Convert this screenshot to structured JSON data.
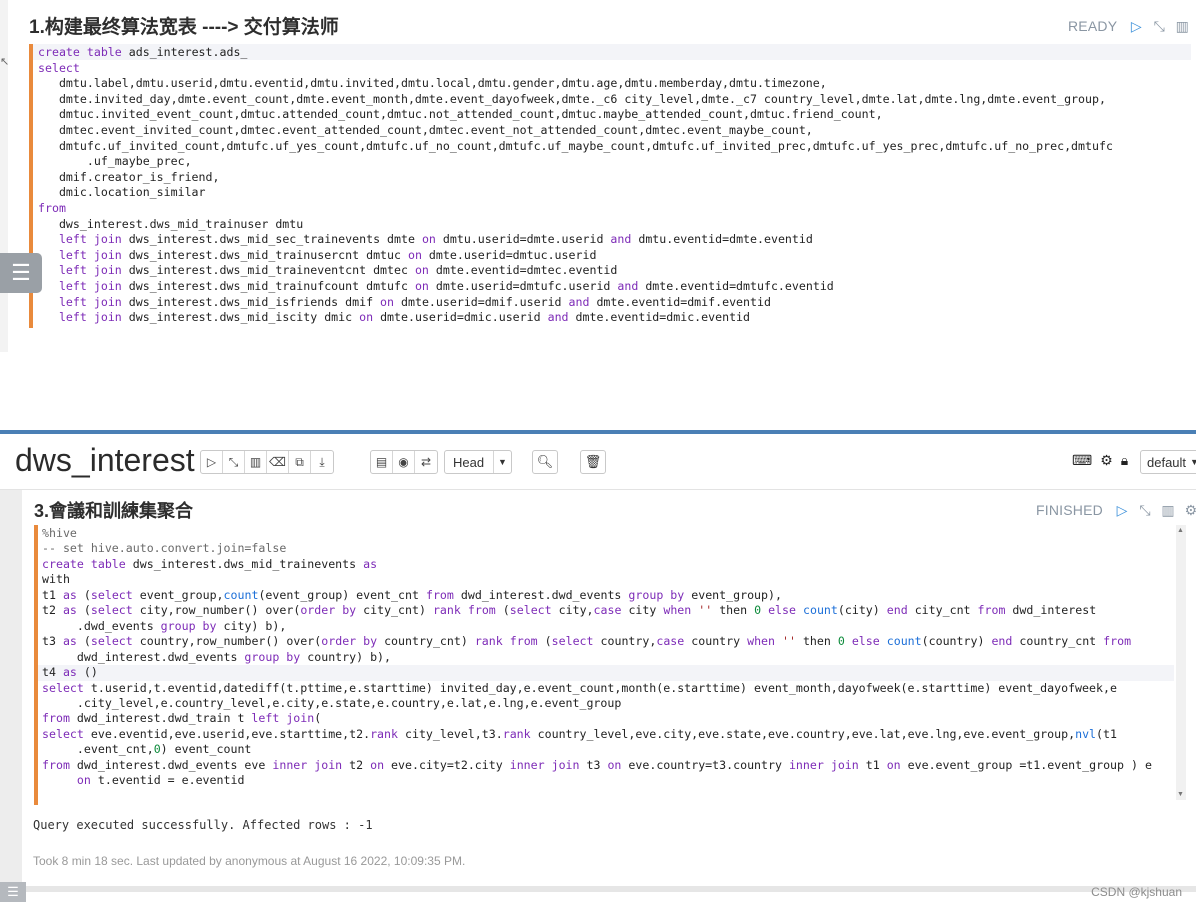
{
  "top_paragraph": {
    "title": "1.构建最终算法宽表 ----> 交付算法师",
    "status": "READY",
    "code_lines": [
      [
        [
          "kw",
          "create table "
        ],
        [
          "",
          "ads_interest.ads_"
        ]
      ],
      [
        [
          "kw",
          "select"
        ]
      ],
      [
        [
          "",
          "   dmtu.label,dmtu.userid,dmtu.eventid,dmtu.invited,dmtu.local,dmtu.gender,dmtu.age,dmtu.memberday,dmtu.timezone,"
        ]
      ],
      [
        [
          "",
          "   dmte.invited_day,dmte.event_count,dmte.event_month,dmte.event_dayofweek,dmte._c6 city_level,dmte._c7 country_level,dmte.lat,dmte.lng,dmte.event_group,"
        ]
      ],
      [
        [
          "",
          "   dmtuc.invited_event_count,dmtuc.attended_count,dmtuc.not_attended_count,dmtuc.maybe_attended_count,dmtuc.friend_count,"
        ]
      ],
      [
        [
          "",
          "   dmtec.event_invited_count,dmtec.event_attended_count,dmtec.event_not_attended_count,dmtec.event_maybe_count,"
        ]
      ],
      [
        [
          "",
          "   dmtufc.uf_invited_count,dmtufc.uf_yes_count,dmtufc.uf_no_count,dmtufc.uf_maybe_count,dmtufc.uf_invited_prec,dmtufc.uf_yes_prec,dmtufc.uf_no_prec,dmtufc"
        ]
      ],
      [
        [
          "",
          "       .uf_maybe_prec,"
        ]
      ],
      [
        [
          "",
          "   dmif.creator_is_friend,"
        ]
      ],
      [
        [
          "",
          "   dmic.location_similar"
        ]
      ],
      [
        [
          "kw",
          "from"
        ]
      ],
      [
        [
          "",
          "   dws_interest.dws_mid_trainuser dmtu"
        ]
      ],
      [
        [
          "",
          "   "
        ],
        [
          "kw",
          "left join "
        ],
        [
          "",
          "dws_interest.dws_mid_sec_trainevents dmte "
        ],
        [
          "kw",
          "on "
        ],
        [
          "",
          "dmtu.userid=dmte.userid "
        ],
        [
          "kw",
          "and "
        ],
        [
          "",
          "dmtu.eventid=dmte.eventid"
        ]
      ],
      [
        [
          "",
          "   "
        ],
        [
          "kw",
          "left join "
        ],
        [
          "",
          "dws_interest.dws_mid_trainusercnt dmtuc "
        ],
        [
          "kw",
          "on "
        ],
        [
          "",
          "dmte.userid=dmtuc.userid"
        ]
      ],
      [
        [
          "",
          "   "
        ],
        [
          "kw",
          "left join "
        ],
        [
          "",
          "dws_interest.dws_mid_traineventcnt dmtec "
        ],
        [
          "kw",
          "on "
        ],
        [
          "",
          "dmte.eventid=dmtec.eventid"
        ]
      ],
      [
        [
          "",
          "   "
        ],
        [
          "kw",
          "left join "
        ],
        [
          "",
          "dws_interest.dws_mid_trainufcount dmtufc "
        ],
        [
          "kw",
          "on "
        ],
        [
          "",
          "dmte.userid=dmtufc.userid "
        ],
        [
          "kw",
          "and "
        ],
        [
          "",
          "dmte.eventid=dmtufc.eventid"
        ]
      ],
      [
        [
          "",
          "   "
        ],
        [
          "kw",
          "left join "
        ],
        [
          "",
          "dws_interest.dws_mid_isfriends dmif "
        ],
        [
          "kw",
          "on "
        ],
        [
          "",
          "dmte.userid=dmif.userid "
        ],
        [
          "kw",
          "and "
        ],
        [
          "",
          "dmte.eventid=dmif.eventid"
        ]
      ],
      [
        [
          "",
          "   "
        ],
        [
          "kw",
          "left join "
        ],
        [
          "",
          "dws_interest.dws_mid_iscity dmic "
        ],
        [
          "kw",
          "on "
        ],
        [
          "",
          "dmte.userid=dmic.userid "
        ],
        [
          "kw",
          "and "
        ],
        [
          "",
          "dmte.eventid=dmic.eventid"
        ]
      ]
    ]
  },
  "notebook": {
    "title": "dws_interest",
    "head_label": "Head",
    "mode_label": "default"
  },
  "bottom_paragraph": {
    "title": "3.會議和訓練集聚合",
    "status": "FINISHED",
    "code_lines": [
      [
        [
          "cm",
          "%hive"
        ]
      ],
      [
        [
          "cm",
          "-- set hive.auto.convert.join=false"
        ]
      ],
      [
        [
          "kw",
          "create table "
        ],
        [
          "",
          "dws_interest.dws_mid_trainevents "
        ],
        [
          "kw",
          "as"
        ]
      ],
      [
        [
          "",
          "with"
        ]
      ],
      [
        [
          "",
          "t1 "
        ],
        [
          "kw",
          "as "
        ],
        [
          "",
          "("
        ],
        [
          "kw",
          "select "
        ],
        [
          "",
          "event_group,"
        ],
        [
          "fn",
          "count"
        ],
        [
          "",
          "(event_group) event_cnt "
        ],
        [
          "kw",
          "from "
        ],
        [
          "",
          "dwd_interest.dwd_events "
        ],
        [
          "kw",
          "group by "
        ],
        [
          "",
          "event_group),"
        ]
      ],
      [
        [
          "",
          "t2 "
        ],
        [
          "kw",
          "as "
        ],
        [
          "",
          "("
        ],
        [
          "kw",
          "select "
        ],
        [
          "",
          "city,row_number() over("
        ],
        [
          "kw",
          "order by "
        ],
        [
          "",
          "city_cnt) "
        ],
        [
          "kw",
          "rank from "
        ],
        [
          "",
          "("
        ],
        [
          "kw",
          "select "
        ],
        [
          "",
          "city,"
        ],
        [
          "kw",
          "case "
        ],
        [
          "",
          "city "
        ],
        [
          "kw",
          "when "
        ],
        [
          "str",
          "'' "
        ],
        [
          "",
          "then "
        ],
        [
          "num",
          "0 "
        ],
        [
          "kw",
          "else "
        ],
        [
          "fn",
          "count"
        ],
        [
          "",
          "(city) "
        ],
        [
          "kw",
          "end "
        ],
        [
          "",
          "city_cnt "
        ],
        [
          "kw",
          "from "
        ],
        [
          "",
          "dwd_interest"
        ]
      ],
      [
        [
          "",
          "     .dwd_events "
        ],
        [
          "kw",
          "group by "
        ],
        [
          "",
          "city) b),"
        ]
      ],
      [
        [
          "",
          "t3 "
        ],
        [
          "kw",
          "as "
        ],
        [
          "",
          "("
        ],
        [
          "kw",
          "select "
        ],
        [
          "",
          "country,row_number() over("
        ],
        [
          "kw",
          "order by "
        ],
        [
          "",
          "country_cnt) "
        ],
        [
          "kw",
          "rank from "
        ],
        [
          "",
          "("
        ],
        [
          "kw",
          "select "
        ],
        [
          "",
          "country,"
        ],
        [
          "kw",
          "case "
        ],
        [
          "",
          "country "
        ],
        [
          "kw",
          "when "
        ],
        [
          "str",
          "'' "
        ],
        [
          "",
          "then "
        ],
        [
          "num",
          "0 "
        ],
        [
          "kw",
          "else "
        ],
        [
          "fn",
          "count"
        ],
        [
          "",
          "(country) "
        ],
        [
          "kw",
          "end "
        ],
        [
          "",
          "country_cnt "
        ],
        [
          "kw",
          "from"
        ]
      ],
      [
        [
          "",
          "     dwd_interest.dwd_events "
        ],
        [
          "kw",
          "group by "
        ],
        [
          "",
          "country) b),"
        ]
      ],
      [
        [
          "",
          "t4 "
        ],
        [
          "kw",
          "as "
        ],
        [
          "",
          "()"
        ]
      ],
      [
        [
          "kw",
          "select "
        ],
        [
          "",
          "t.userid,t.eventid,datediff(t.pttime,e.starttime) invited_day,e.event_count,month(e.starttime) event_month,dayofweek(e.starttime) event_dayofweek,e"
        ]
      ],
      [
        [
          "",
          "     .city_level,e.country_level,e.city,e.state,e.country,e.lat,e.lng,e.event_group"
        ]
      ],
      [
        [
          "kw",
          "from "
        ],
        [
          "",
          "dwd_interest.dwd_train t "
        ],
        [
          "kw",
          "left join"
        ],
        [
          "",
          "("
        ]
      ],
      [
        [
          "kw",
          "select "
        ],
        [
          "",
          "eve.eventid,eve.userid,eve.starttime,t2."
        ],
        [
          "kw",
          "rank "
        ],
        [
          "",
          "city_level,t3."
        ],
        [
          "kw",
          "rank "
        ],
        [
          "",
          "country_level,eve.city,eve.state,eve.country,eve.lat,eve.lng,eve.event_group,"
        ],
        [
          "fn",
          "nvl"
        ],
        [
          "",
          "(t1"
        ]
      ],
      [
        [
          "",
          "     .event_cnt,"
        ],
        [
          "num",
          "0"
        ],
        [
          "",
          ") event_count"
        ]
      ],
      [
        [
          "kw",
          "from "
        ],
        [
          "",
          "dwd_interest.dwd_events eve "
        ],
        [
          "kw",
          "inner join "
        ],
        [
          "",
          "t2 "
        ],
        [
          "kw",
          "on "
        ],
        [
          "",
          "eve.city=t2.city "
        ],
        [
          "kw",
          "inner join "
        ],
        [
          "",
          "t3 "
        ],
        [
          "kw",
          "on "
        ],
        [
          "",
          "eve.country=t3.country "
        ],
        [
          "kw",
          "inner join "
        ],
        [
          "",
          "t1 "
        ],
        [
          "kw",
          "on "
        ],
        [
          "",
          "eve.event_group =t1.event_group ) e"
        ]
      ],
      [
        [
          "",
          "     "
        ],
        [
          "kw",
          "on "
        ],
        [
          "",
          "t.eventid = e.eventid"
        ]
      ]
    ],
    "result_text": "Query executed successfully. Affected rows : -1",
    "took_text": "Took 8 min 18 sec. Last updated by anonymous at August 16 2022, 10:09:35 PM."
  },
  "watermark": "CSDN @kjshuan",
  "colors": {
    "editor_border": "#e98a3c",
    "keyword": "#7d2bb7",
    "function": "#1c6fd8",
    "notebook_accent": "#4a7fb5",
    "status_text": "#8a96a3"
  },
  "icons": [
    "play-icon",
    "collapse-icon",
    "book-icon",
    "eraser-icon",
    "clone-icon",
    "export-icon",
    "notebook-icon",
    "circle-icon",
    "swap-icon",
    "search-icon",
    "trash-icon",
    "keyboard-icon",
    "gear-icon",
    "lock-icon",
    "menu-icon"
  ]
}
